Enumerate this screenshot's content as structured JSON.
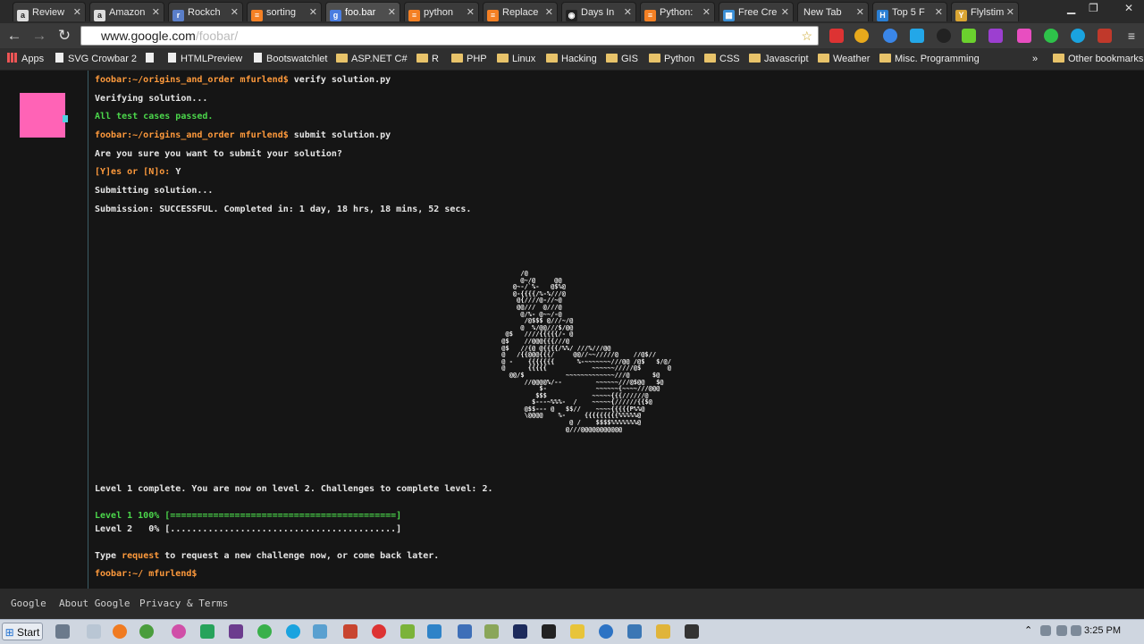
{
  "browser": {
    "tabs": [
      {
        "label": "Review",
        "icon": "amazon-icon"
      },
      {
        "label": "Amazon",
        "icon": "amazon-icon"
      },
      {
        "label": "Rockch",
        "icon": "rockchip-icon"
      },
      {
        "label": "sorting",
        "icon": "stackoverflow-icon"
      },
      {
        "label": "foo.bar",
        "icon": "google-icon",
        "active": true
      },
      {
        "label": "python",
        "icon": "stackoverflow-icon"
      },
      {
        "label": "Replace",
        "icon": "stackoverflow-icon"
      },
      {
        "label": "Days In",
        "icon": "github-icon"
      },
      {
        "label": "Python:",
        "icon": "stackoverflow-icon"
      },
      {
        "label": "Free Cre",
        "icon": "page-icon"
      },
      {
        "label": "New Tab",
        "icon": "blank-icon"
      },
      {
        "label": "Top 5 F",
        "icon": "h-icon"
      },
      {
        "label": "Flylstim",
        "icon": "flylstim-icon"
      }
    ],
    "url_host": "www.google.com",
    "url_path": "/foobar/",
    "bookmarks": [
      {
        "label": "Apps",
        "type": "apps"
      },
      {
        "label": "SVG Crowbar 2",
        "type": "page"
      },
      {
        "label": "",
        "type": "page"
      },
      {
        "label": "HTMLPreview",
        "type": "page"
      },
      {
        "label": "Bootswatchlet",
        "type": "page"
      },
      {
        "label": "ASP.NET C#",
        "type": "folder"
      },
      {
        "label": "R",
        "type": "folder"
      },
      {
        "label": "PHP",
        "type": "folder"
      },
      {
        "label": "Linux",
        "type": "folder"
      },
      {
        "label": "Hacking",
        "type": "folder"
      },
      {
        "label": "GIS",
        "type": "folder"
      },
      {
        "label": "Python",
        "type": "folder"
      },
      {
        "label": "CSS",
        "type": "folder"
      },
      {
        "label": "Javascript",
        "type": "folder"
      },
      {
        "label": "Weather",
        "type": "folder"
      },
      {
        "label": "Misc. Programming",
        "type": "folder"
      }
    ],
    "overflow": "»",
    "other_bookmarks": "Other bookmarks"
  },
  "terminal": {
    "line1_prompt": "foobar:~/origins_and_order mfurlend$",
    "line1_cmd": " verify solution.py",
    "line2": "Verifying solution...",
    "line3": "All test cases passed.",
    "line4_prompt": "foobar:~/origins_and_order mfurlend$",
    "line4_cmd": " submit solution.py",
    "line5": "Are you sure you want to submit your solution?",
    "line6_opts": "[Y]es or [N]o:",
    "line6_ans": " Y",
    "line7": "Submitting solution...",
    "line8": "Submission: SUCCESSFUL. Completed in: 1 day, 18 hrs, 18 mins, 52 secs.",
    "ascii_art": "           /@\n           @~/@     @@\n         @~-/`%-   @$%@\n         @-{{{{/%-%///@\n          @{////@-//~@\n          @@///  @///@\n           @/%- @~~/-@\n            /@$$$ @///~/@\n           @  %/@@///$/@@\n       @$   ////{{{{{/- @\n      @$    //@@@{{{///@\n      @$   //{@ @{{{{/%%/ ///%///@@\n      @   /{{@@@{{{/     @@//~~/////@    //@$//\n      @ -    {{{{{{{      %-~~~~~~~///@@ /@$   $/@/\n      @      {{{{{            ~~~~~~/////@$       @\n        @@/$           ~~~~~~~~~~~~~///@      $@\n            //@@@@%/--         ~~~~~~///@$@@   $@\n                $-             ~~~~~~{~~~~///@@@\n               $$$            ~~~~~{{{//////@\n              $---~%%%-  /    ~~~~~{//////{{$@\n            @$$--- @   $$//    ~~~~{{{{{P%%@\n            \\@@@@    %-     {{{{{{{{{%%%%%@\n                        @ /    $$$$%%%%%%%@\n                       @///@@@@@@@@@@@",
    "level_msg": "Level 1 complete. You are now on level 2. Challenges to complete level: 2.",
    "level1_label": "Level 1 100%",
    "level1_bar": "[==========================================]",
    "level1_progress": 1.0,
    "level2_label": "Level 2   0%",
    "level2_bar": "[..........................................]",
    "level2_progress": 0.0,
    "type_pre": "Type ",
    "type_kw": "request",
    "type_post": " to request a new challenge now, or come back later.",
    "final_prompt": "foobar:~/ mfurlend$"
  },
  "footer": {
    "links": [
      "Google",
      "About Google",
      "Privacy & Terms"
    ]
  },
  "taskbar": {
    "start_label": "Start",
    "clock": "3:25 PM"
  },
  "colors": {
    "avatar": "#ff63b6",
    "prompt": "#ff9a3c",
    "success": "#4bd64b"
  }
}
